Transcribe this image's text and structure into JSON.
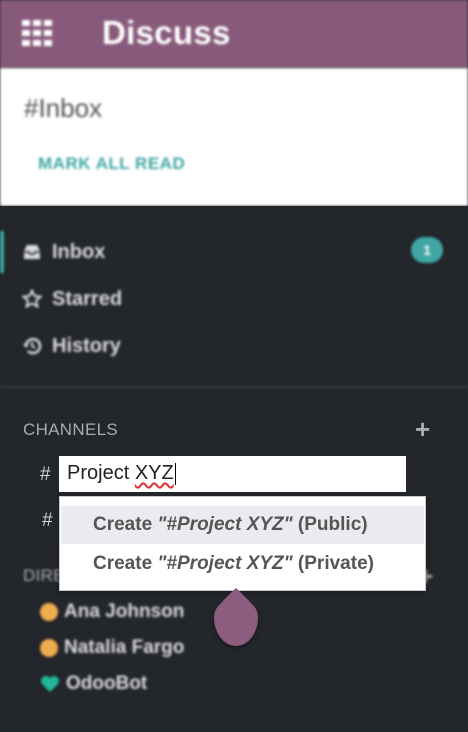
{
  "topbar": {
    "title": "Discuss"
  },
  "control_panel": {
    "title": "#Inbox",
    "mark_all_read": "MARK ALL READ"
  },
  "sidebar": {
    "mailboxes": [
      {
        "label": "Inbox",
        "badge": "1",
        "icon": "inbox-icon"
      },
      {
        "label": "Starred",
        "icon": "star-icon"
      },
      {
        "label": "History",
        "icon": "history-icon"
      }
    ],
    "channels_header": "CHANNELS",
    "channel_hash": "#",
    "channel_input": {
      "value": "Project XYZ",
      "value_main": "Project ",
      "value_typo": "XYZ"
    },
    "dropdown": [
      {
        "prefix": "Create ",
        "name": "\"#Project XYZ\"",
        "suffix": " (Public)"
      },
      {
        "prefix": "Create ",
        "name": "\"#Project XYZ\"",
        "suffix": " (Private)"
      }
    ],
    "direct_messages_header": "DIRE",
    "partners": [
      {
        "name": "Ana Johnson",
        "status_color": "#f0ad4e"
      },
      {
        "name": "Natalia Fargo",
        "status_color": "#f0ad4e"
      },
      {
        "name": "OdooBot",
        "status_color": "#21b799"
      }
    ]
  },
  "colors": {
    "brand": "#875a7b",
    "accent": "#3fa6a4",
    "sidebar_bg": "#23262b"
  }
}
